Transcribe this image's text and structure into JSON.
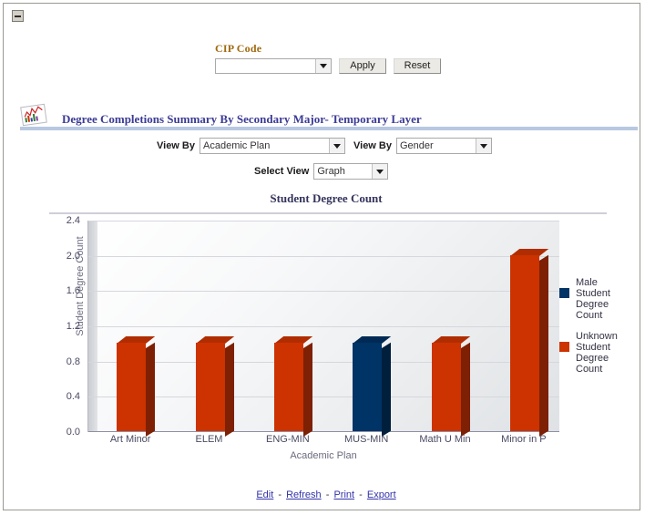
{
  "window": {
    "collapse_icon": "minus-box-icon"
  },
  "prompt": {
    "label": "CIP Code",
    "select_value": "",
    "select_placeholder": "",
    "apply_label": "Apply",
    "reset_label": "Reset"
  },
  "report": {
    "icon": "report-chart-icon",
    "title": "Degree Completions Summary By Secondary Major- Temporary Layer"
  },
  "controls": {
    "view_by_1_label": "View By",
    "view_by_1_value": "Academic Plan",
    "view_by_2_label": "View By",
    "view_by_2_value": "Gender",
    "select_view_label": "Select View",
    "select_view_value": "Graph"
  },
  "footer": {
    "edit": "Edit",
    "refresh": "Refresh",
    "print": "Print",
    "export": "Export",
    "separator": "-"
  },
  "colors": {
    "male": "#003366",
    "unknown": "#cc3300",
    "title": "#3b3b96",
    "prompt_label": "#a06a10",
    "link": "#3333aa"
  },
  "chart_data": {
    "type": "bar",
    "title": "Student Degree Count",
    "xlabel": "Academic Plan",
    "ylabel": "Student Degree Count",
    "categories": [
      "Art Minor",
      "ELEM",
      "ENG-MIN",
      "MUS-MIN",
      "Math U Min",
      "Minor in P"
    ],
    "series": [
      {
        "name": "Male Student Degree Count",
        "color": "#003366",
        "values": [
          0,
          0,
          0,
          1,
          0,
          0
        ]
      },
      {
        "name": "Unknown Student Degree Count",
        "color": "#cc3300",
        "values": [
          1,
          1,
          1,
          0,
          1,
          2
        ]
      }
    ],
    "bar_series_index": [
      1,
      1,
      1,
      0,
      1,
      1
    ],
    "bar_values": [
      1,
      1,
      1,
      1,
      1,
      2
    ],
    "ylim": [
      0,
      2.4
    ],
    "yticks": [
      0.0,
      0.4,
      0.8,
      1.2,
      1.6,
      2.0,
      2.4
    ],
    "ytick_labels": [
      "0.0",
      "0.4",
      "0.8",
      "1.2",
      "1.6",
      "2.0",
      "2.4"
    ],
    "grid": true,
    "legend_position": "right",
    "legend": [
      {
        "label": "Male Student Degree Count",
        "color": "#003366"
      },
      {
        "label": "Unknown Student Degree Count",
        "color": "#cc3300"
      }
    ]
  }
}
